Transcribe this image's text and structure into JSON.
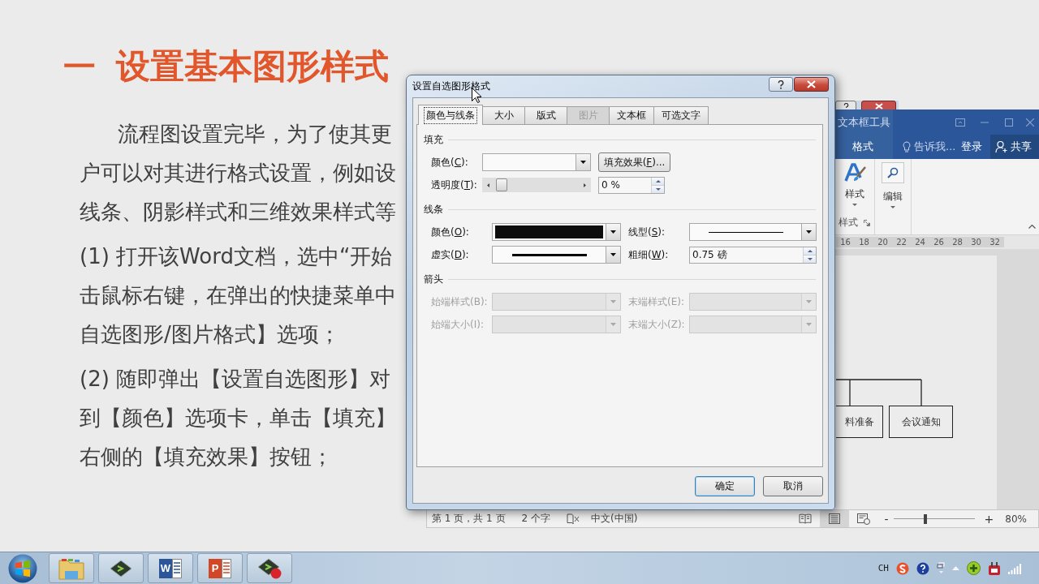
{
  "slide": {
    "heading": {
      "number": "一",
      "text": "设置基本图形样式"
    },
    "paragraphs": [
      {
        "indented": true,
        "lines": [
          "流程图设置完毕，为了使其更",
          "户可以对其进行格式设置，例如设",
          "线条、阴影样式和三维效果样式等"
        ]
      },
      {
        "indented": false,
        "lines": [
          "(1) 打开该Word文档，选中“开始",
          "击鼠标右键，在弹出的快捷菜单中",
          "自选图形/图片格式】选项；"
        ]
      },
      {
        "indented": false,
        "lines": [
          "(2) 随即弹出【设置自选图形】对",
          "到【颜色】选项卡，单击【填充】",
          "右侧的【填充效果】按钮；"
        ]
      }
    ]
  },
  "dialog": {
    "title": "设置自选图形格式",
    "tabs": [
      {
        "label": "颜色与线条",
        "selected": true,
        "disabled": false
      },
      {
        "label": "大小",
        "selected": false,
        "disabled": false
      },
      {
        "label": "版式",
        "selected": false,
        "disabled": false
      },
      {
        "label": "图片",
        "selected": false,
        "disabled": true
      },
      {
        "label": "文本框",
        "selected": false,
        "disabled": false
      },
      {
        "label": "可选文字",
        "selected": false,
        "disabled": false
      }
    ],
    "sections": [
      {
        "title": "填充",
        "rows": [
          {
            "fields": [
              {
                "kind": "dropdown",
                "label": "颜色(",
                "access_key": "C",
                "label_end": "):",
                "disabled": false
              },
              {
                "kind": "button",
                "label": "填充效果(",
                "access_key": "F",
                "label_end": ")...",
                "disabled": false
              }
            ]
          },
          {
            "fields": [
              {
                "kind": "slider",
                "label": "透明度(",
                "access_key": "T",
                "label_end": "):",
                "level": 0,
                "disabled": false
              },
              {
                "kind": "spin",
                "value": "0 %",
                "disabled": false
              }
            ]
          }
        ]
      },
      {
        "title": "线条",
        "rows": [
          {
            "fields": [
              {
                "kind": "color",
                "label": "颜色(",
                "access_key": "O",
                "label_end": "):",
                "color": "#0d0d0d",
                "disabled": false
              },
              {
                "kind": "line_style",
                "label": "线型(",
                "access_key": "S",
                "label_end": "):",
                "disabled": false
              }
            ]
          },
          {
            "fields": [
              {
                "kind": "dash_style",
                "label": "虚实(",
                "access_key": "D",
                "label_end": "):",
                "disabled": false
              },
              {
                "kind": "spin",
                "label": "粗细(",
                "access_key": "W",
                "label_end": "):",
                "value": "0.75 磅",
                "disabled": false
              }
            ]
          }
        ]
      },
      {
        "title": "箭头",
        "rows": [
          {
            "fields": [
              {
                "kind": "dropdown",
                "label": "始端样式(",
                "access_key": "B",
                "label_end": "):",
                "disabled": true
              },
              {
                "kind": "dropdown",
                "label": "末端样式(",
                "access_key": "E",
                "label_end": "):",
                "disabled": true
              }
            ]
          },
          {
            "fields": [
              {
                "kind": "dropdown",
                "label": "始端大小(",
                "access_key": "I",
                "label_end": "):",
                "disabled": true
              },
              {
                "kind": "dropdown",
                "label": "末端大小(",
                "access_key": "Z",
                "label_end": "):",
                "disabled": true
              }
            ]
          }
        ]
      }
    ],
    "buttons": [
      {
        "label": "确定",
        "default": true
      },
      {
        "label": "取消",
        "default": false
      }
    ]
  },
  "word_window": {
    "contextual_tab_group": "文本框工具",
    "tabs": [
      {
        "label": "格式",
        "selected": false
      }
    ],
    "tell_me": "告诉我...",
    "sign_in": "登录",
    "share": "共享",
    "ribbon": {
      "groups": [
        {
          "label": "样式",
          "buttons": [
            {
              "kind": "styles",
              "label": "样式"
            }
          ]
        },
        {
          "buttons": [
            {
              "kind": "find",
              "label": "编辑"
            }
          ]
        }
      ]
    },
    "ruler": [
      "16",
      "18",
      "20",
      "22",
      "24",
      "26",
      "28",
      "30",
      "32"
    ],
    "flowchart": {
      "nodes": [
        {
          "label": "料准备",
          "clipped": true
        },
        {
          "label": "会议通知",
          "clipped": false
        }
      ]
    },
    "status_bar": {
      "page": "第 1 页，共 1 页",
      "words": "2 个字",
      "language": "中文(中国)",
      "views": [
        {
          "kind": "read",
          "selected": false
        },
        {
          "kind": "print",
          "selected": true
        },
        {
          "kind": "web",
          "selected": false
        }
      ],
      "zoom_out": "-",
      "zoom": {
        "level": 0.39
      },
      "zoom_in": "+",
      "zoom_label": "80%"
    }
  },
  "taskbar": {
    "apps": [
      {
        "kind": "folder"
      },
      {
        "kind": "console"
      },
      {
        "kind": "document_app",
        "label": "W"
      },
      {
        "kind": "slides_app",
        "label": "P"
      },
      {
        "kind": "console_alert"
      }
    ],
    "tray": {
      "input_language": "CH"
    }
  }
}
